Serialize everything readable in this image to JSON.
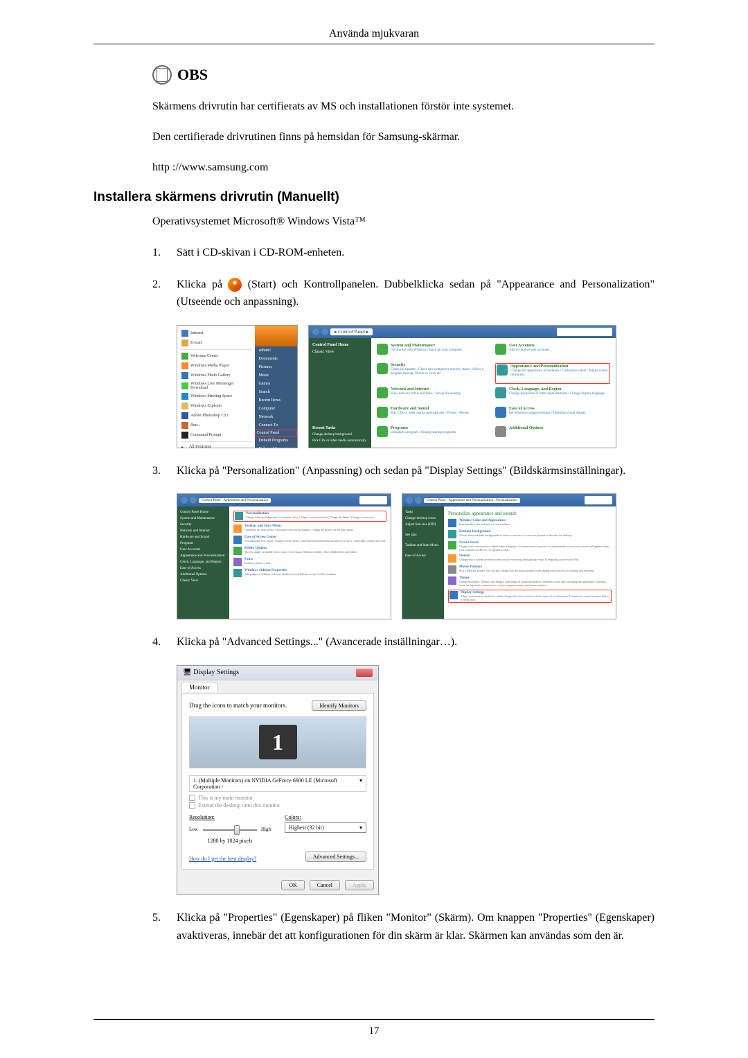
{
  "header": {
    "title": "Använda mjukvaran"
  },
  "obs": {
    "label": "OBS",
    "p1": "Skärmens drivrutin har certifierats av MS och installationen förstör inte systemet.",
    "p2": "Den certifierade drivrutinen finns på hemsidan för Samsung-skärmar.",
    "url": "http ://www.samsung.com"
  },
  "section": {
    "heading": "Installera skärmens drivrutin (Manuellt)",
    "intro": "Operativsystemet Microsoft® Windows Vista™",
    "steps": {
      "1": "Sätt i CD-skivan i CD-ROM-enheten.",
      "2a": "Klicka på ",
      "2b": " (Start) och Kontrollpanelen. Dubbelklicka sedan på \"Appearance and Personalization\" (Utseende och anpassning).",
      "3": "Klicka på \"Personalization\" (Anpassning) och sedan på \"Display Settings\" (Bildskärmsinställningar).",
      "4": "Klicka på \"Advanced Settings...\" (Avancerade inställningar…).",
      "5": "Klicka på \"Properties\" (Egenskaper) på fliken \"Monitor\" (Skärm). Om knappen \"Properties\" (Egenskaper) avaktiveras, innebär det att konfigurationen för din skärm är klar. Skärmen kan användas som den är."
    }
  },
  "startMenu": {
    "items": [
      "Internet",
      "E-mail",
      "Welcome Center",
      "Windows Media Player",
      "Windows Photo Gallery",
      "Windows Live Messenger Download",
      "Windows Meeting Space",
      "Windows Explorer",
      "Adobe Photoshop CS3",
      "Run...",
      "Command Prompt"
    ],
    "allPrograms": "All Programs",
    "rightItems": [
      "admin1",
      "Documents",
      "Pictures",
      "Music",
      "Games",
      "Search",
      "Recent Items",
      "Computer",
      "Network",
      "Connect To",
      "Control Panel",
      "Default Programs",
      "Help and Support"
    ]
  },
  "controlPanel": {
    "breadcrumb": "Control Panel",
    "sidebar": {
      "title": "Control Panel Home",
      "classic": "Classic View",
      "recentTasks": "Recent Tasks",
      "recent1": "Change desktop background",
      "recent2": "Pick CDs or other media automatically"
    },
    "cats": [
      {
        "t": "System and Maintenance",
        "s": "Get started with Windows / Back up your computer",
        "c": "clr-green"
      },
      {
        "t": "User Accounts",
        "s": "Add or remove user accounts",
        "c": "clr-green"
      },
      {
        "t": "Security",
        "s": "Check for updates / Check this computer's security status / Allow a program through Windows Firewall",
        "c": "clr-green"
      },
      {
        "t": "Appearance and Personalization",
        "s": "Change the appearance of desktops / Customize colors / Adjust screen resolution",
        "c": "clr-teal"
      },
      {
        "t": "Network and Internet",
        "s": "View network status and tasks / Set up file sharing",
        "c": "clr-green"
      },
      {
        "t": "Clock, Language, and Region",
        "s": "Change keyboards or other input methods / Change display language",
        "c": "clr-teal"
      },
      {
        "t": "Hardware and Sound",
        "s": "Play CDs or other media automatically / Printer / Mouse",
        "c": "clr-green"
      },
      {
        "t": "Ease of Access",
        "s": "Let Windows suggest settings / Optimize visual display",
        "c": "clr-blue"
      },
      {
        "t": "Programs",
        "s": "Uninstall a program / Change startup programs",
        "c": "clr-green"
      },
      {
        "t": "Additional Options",
        "s": "",
        "c": "clr-gray"
      }
    ]
  },
  "personalize1": {
    "breadcrumb": "Control Panel › Appearance and Personalization",
    "sidebar": [
      "Control Panel Home",
      "System and Maintenance",
      "Security",
      "Network and Internet",
      "Hardware and Sound",
      "Programs",
      "User Accounts",
      "Appearance and Personalization",
      "Clock, Language, and Region",
      "Ease of Access",
      "Additional Options",
      "Classic View"
    ],
    "items": [
      {
        "t": "Personalization",
        "s": "Change desktop background | Customize colors | Adjust screen resolution | Change the theme | Change screen saver"
      },
      {
        "t": "Taskbar and Start Menu",
        "s": "Customize the Start menu | Customize icons on the taskbar | Change the picture on the Start menu"
      },
      {
        "t": "Ease of Access Center",
        "s": "Accommodate low vision | Change screen reader | Underline keyboard shortcuts and access keys | Turn High Contrast on or off"
      },
      {
        "t": "Folder Options",
        "s": "Specify single- or double-click to open | Use Classic Windows folders | Show hidden files and folders"
      },
      {
        "t": "Fonts",
        "s": "Install or remove a font"
      },
      {
        "t": "Windows Sidebar Properties",
        "s": "Add gadgets to Sidebar | Choose whether to keep Sidebar on top of other windows"
      }
    ]
  },
  "personalize2": {
    "breadcrumb": "Control Panel › Appearance and Personalization › Personalization",
    "sidebar": [
      "Tasks",
      "Change desktop icons",
      "Adjust font size (DPI)"
    ],
    "heading": "Personalize appearance and sounds",
    "items": [
      {
        "t": "Window Color and Appearance",
        "s": "Fine tune the color and style of your windows"
      },
      {
        "t": "Desktop Background",
        "s": "Choose from available backgrounds or colors or use one of your own pictures to decorate the desktop"
      },
      {
        "t": "Screen Saver",
        "s": "Change your screen saver or adjust when it displays. A screen saver is a picture or animation that covers your screen and appears when your computer is idle for a set period of time."
      },
      {
        "t": "Sounds",
        "s": "Change which sounds are heard when you do everything from getting e-mail to emptying your Recycle Bin"
      },
      {
        "t": "Mouse Pointers",
        "s": "Pick a different pointer. You can also change how the mouse pointer looks during such activities as clicking and selecting"
      },
      {
        "t": "Theme",
        "s": "Change the theme. Themes can change a wide range of visual and auditory elements at one time, including the appearance of menus, icons, backgrounds, screen savers, some computer sounds, and mouse pointers"
      },
      {
        "t": "Display Settings",
        "s": "Adjust your monitor resolution, which changes the view so more or fewer items fit on the screen. You can also control monitor flicker (refresh rate)."
      }
    ],
    "seeAlso": [
      "See also",
      "Taskbar and Start Menu",
      "Ease of Access"
    ]
  },
  "display": {
    "title": "Display Settings",
    "tab": "Monitor",
    "instruction": "Drag the icons to match your monitors.",
    "identify": "Identify Monitors",
    "monitorNum": "1",
    "monitorList": "1. (Multiple Monitors) on NVIDIA GeForce 6600 LE (Microsoft Corporation - ",
    "check1": "This is my main monitor",
    "check2": "Extend the desktop onto this monitor",
    "resolution": "Resolution:",
    "low": "Low",
    "high": "High",
    "resValue": "1280 by 1024 pixels",
    "colors": "Colors:",
    "colorValue": "Highest (32 bit)",
    "helpLink": "How do I get the best display?",
    "advanced": "Advanced Settings...",
    "ok": "OK",
    "cancel": "Cancel",
    "apply": "Apply"
  },
  "pageNum": "17"
}
